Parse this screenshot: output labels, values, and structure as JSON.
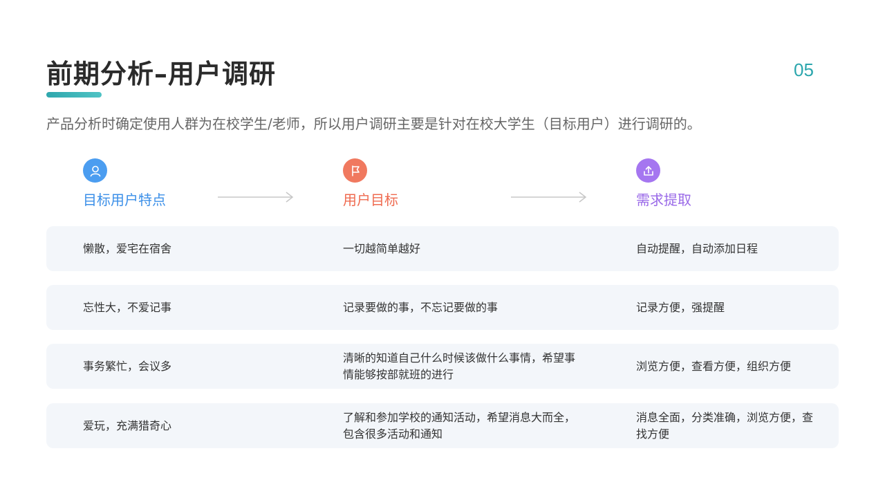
{
  "header": {
    "title": "前期分析–用户调研",
    "page_number": "05",
    "intro": "产品分析时确定使用人群为在校学生/老师，所以用户调研主要是针对在校大学生（目标用户）进行调研的。"
  },
  "columns": [
    {
      "label": "目标用户特点",
      "icon": "user-icon",
      "color": "#4b9df0"
    },
    {
      "label": "用户目标",
      "icon": "flag-icon",
      "color": "#f0795f"
    },
    {
      "label": "需求提取",
      "icon": "upload-icon",
      "color": "#a576f0"
    }
  ],
  "rows": [
    {
      "trait": "懒散，爱宅在宿舍",
      "goal": "一切越简单越好",
      "need": "自动提醒，自动添加日程"
    },
    {
      "trait": "忘性大，不爱记事",
      "goal": "记录要做的事，不忘记要做的事",
      "need": "记录方便，强提醒"
    },
    {
      "trait": "事务繁忙，会议多",
      "goal": "清晰的知道自己什么时候该做什么事情，希望事情能够按部就班的进行",
      "need": "浏览方便，查看方便，组织方便"
    },
    {
      "trait": "爱玩，充满猎奇心",
      "goal": "了解和参加学校的通知活动，希望消息大而全，包含很多活动和通知",
      "need": "消息全面，分类准确，浏览方便，查找方便"
    }
  ]
}
